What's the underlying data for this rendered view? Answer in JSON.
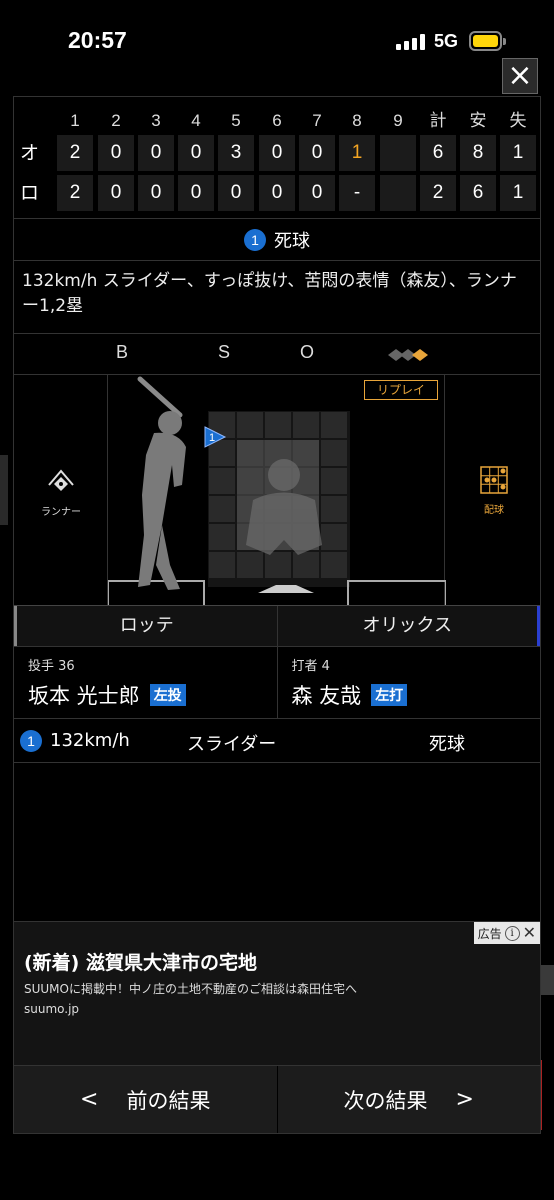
{
  "status": {
    "time": "20:57",
    "network": "5G"
  },
  "close_label": "×",
  "scoreboard": {
    "innings": [
      "1",
      "2",
      "3",
      "4",
      "5",
      "6",
      "7",
      "8",
      "9"
    ],
    "totals_headers": [
      "計",
      "安",
      "失"
    ],
    "teams": [
      {
        "abbr": "オ",
        "innings": [
          "2",
          "0",
          "0",
          "0",
          "3",
          "0",
          "0",
          "1",
          ""
        ],
        "totals": [
          "6",
          "8",
          "1"
        ]
      },
      {
        "abbr": "ロ",
        "innings": [
          "2",
          "0",
          "0",
          "0",
          "0",
          "0",
          "0",
          "-",
          ""
        ],
        "totals": [
          "2",
          "6",
          "1"
        ]
      }
    ]
  },
  "event": {
    "number": "1",
    "label": "死球"
  },
  "description": "132km/h スライダー、すっぽ抜け、苦悶の表情（森友）、ランナー1,2塁",
  "bso": {
    "b": "B",
    "s": "S",
    "o": "O"
  },
  "field": {
    "runner_label": "ランナー",
    "pitch_label": "配球",
    "replay_label": "リプレイ",
    "pitch_marker": "1"
  },
  "tabs": {
    "left": "ロッテ",
    "right": "オリックス"
  },
  "pitcher": {
    "role": "投手 36",
    "name": "坂本 光士郎",
    "hand": "左投"
  },
  "batter": {
    "role": "打者 4",
    "name": "森 友哉",
    "hand": "左打"
  },
  "pitch": {
    "number": "1",
    "speed": "132km/h",
    "type": "スライダー",
    "result": "死球"
  },
  "ad": {
    "tag": "広告",
    "title": "(新着) 滋賀県大津市の宅地",
    "body": "SUUMOに掲載中！中ノ庄の土地不動産のご相談は森田住宅へ",
    "url": "suumo.jp"
  },
  "nav": {
    "prev": "前の結果",
    "next": "次の結果",
    "prev_chev": "<",
    "next_chev": ">"
  },
  "colors": {
    "accent_blue": "#1a6fd1",
    "accent_orange": "#e8a53a"
  }
}
